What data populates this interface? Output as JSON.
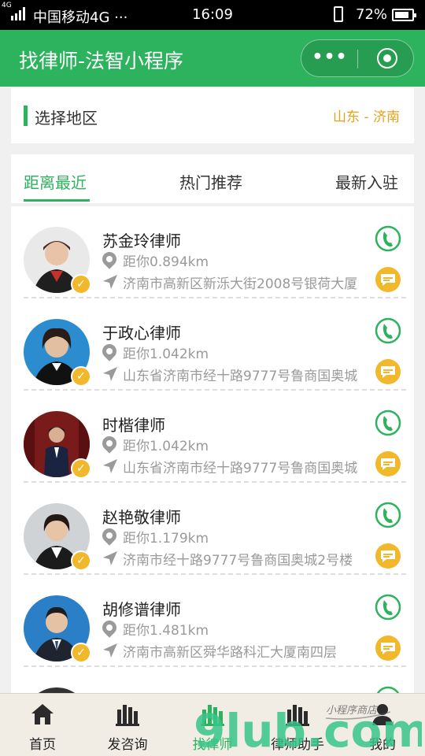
{
  "status_bar": {
    "network_small": "4G",
    "carrier": "中国移动4G ···",
    "time": "16:09",
    "battery": "72%"
  },
  "nav": {
    "title": "找律师-法智小程序",
    "more_label": "•••"
  },
  "region": {
    "label": "选择地区",
    "value": "山东 - 济南"
  },
  "tabs": [
    {
      "label": "距离最近",
      "active": true
    },
    {
      "label": "热门推荐",
      "active": false
    },
    {
      "label": "最新入驻",
      "active": false
    }
  ],
  "lawyers": [
    {
      "name": "苏金玲律师",
      "distance": "距你0.894km",
      "address": "济南市高新区新泺大街2008号银荷大厦",
      "verified_glyph": "✓"
    },
    {
      "name": "于政心律师",
      "distance": "距你1.042km",
      "address": "山东省济南市经十路9777号鲁商国奥城",
      "verified_glyph": "✓"
    },
    {
      "name": "时楷律师",
      "distance": "距你1.042km",
      "address": "山东省济南市经十路9777号鲁商国奥城",
      "verified_glyph": "✓"
    },
    {
      "name": "赵艳敬律师",
      "distance": "距你1.179km",
      "address": "济南市经十路9777号鲁商国奥城2号楼",
      "verified_glyph": "✓"
    },
    {
      "name": "胡修谱律师",
      "distance": "距你1.481km",
      "address": "济南市高新区舜华路科汇大厦南四层",
      "verified_glyph": "✓"
    }
  ],
  "tabbar": [
    {
      "label": "首页",
      "icon": "home-icon",
      "active": false
    },
    {
      "label": "发咨询",
      "icon": "consult-icon",
      "active": false
    },
    {
      "label": "找律师",
      "icon": "find-lawyer-icon",
      "active": true
    },
    {
      "label": "律师助手",
      "icon": "assistant-icon",
      "active": false
    },
    {
      "label": "我的",
      "icon": "profile-icon",
      "active": false
    }
  ],
  "watermark": {
    "brand": "9lub.com",
    "caption": "小程序商店"
  },
  "colors": {
    "primary_green": "#2db35d",
    "accent_orange": "#e5a218",
    "badge_yellow": "#f2b82c"
  }
}
